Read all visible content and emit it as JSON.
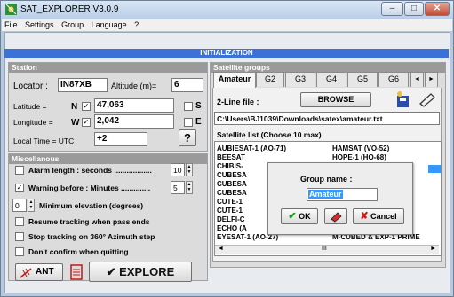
{
  "window": {
    "title": "SAT_EXPLORER V3.0.9",
    "minimize": "–",
    "maximize": "□",
    "close": "✕"
  },
  "menu": [
    "File",
    "Settings",
    "Group",
    "Language",
    "?"
  ],
  "banner": "INITIALIZATION",
  "station": {
    "title": "Station",
    "locator_label": "Locator :",
    "locator_value": "IN87XB",
    "altitude_label": "Altitude (m)=",
    "altitude_value": "6",
    "latitude_label": "Latitude =",
    "lat_hemi": "N",
    "latitude_value": "47,063",
    "s_label": "S",
    "longitude_label": "Longitude =",
    "lon_hemi": "W",
    "longitude_value": "2,042",
    "e_label": "E",
    "localtime_label": "Local Time = UTC",
    "localtime_value": "+2",
    "help_label": "?"
  },
  "misc": {
    "title": "Miscellanous",
    "alarm_label": "Alarm length : seconds ..................",
    "alarm_value": "10",
    "warning_label": "Warning before : Minutes ..............",
    "warning_value": "5",
    "min_elev_value": "0",
    "min_elev_label": "Minimum elevation (degrees)",
    "resume_label": "Resume tracking when pass ends",
    "stop_label": "Stop tracking on 360° Azimuth step",
    "noconfirm_label": "Don't confirm when quitting"
  },
  "bottom": {
    "ant_label": "ANT",
    "explore_label": "✔ EXPLORE"
  },
  "groups": {
    "title": "Satellite groups",
    "tabs": [
      "Amateur",
      "G2",
      "G3",
      "G4",
      "G5",
      "G6"
    ],
    "tab_prev": "◄",
    "tab_next": "►",
    "twoline_label": "2-Line file :",
    "browse_label": "BROWSE",
    "path": "C:\\Users\\BJ1039\\Downloads\\satex\\amateur.txt",
    "list_title": "Satellite list (Choose 10 max)",
    "list_col1": [
      "AUBIESAT-1 (AO-71)",
      "BEESAT",
      "CHIBIS-",
      "CUBESA",
      "CUBESA",
      "CUBESA",
      "CUTE-1",
      "CUTE-1",
      "DELFI-C",
      "ECHO (A",
      "EYESAT-1 (AO-27)"
    ],
    "list_col2": [
      "HAMSAT (VO-52)",
      "HOPE-1 (HO-68)",
      "M-CUBED & EXP-1 PRIME"
    ],
    "scroll_mid": "III"
  },
  "dialog": {
    "title": "Group name :",
    "value": "Amateur",
    "ok_label": "OK",
    "cancel_label": "Cancel"
  },
  "colors": {
    "banner": "#3a72d8",
    "explore_check": "#1a9a1a",
    "cancel_x": "#cc1a10"
  }
}
